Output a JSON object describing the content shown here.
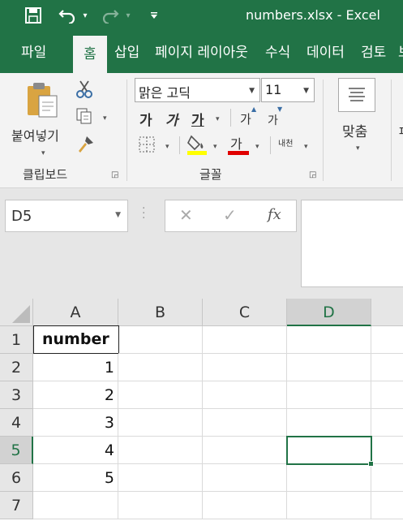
{
  "title_bar": {
    "title": "numbers.xlsx  -  Excel",
    "qat": [
      {
        "name": "save-icon",
        "glyph": "💾"
      },
      {
        "name": "undo-icon",
        "glyph": "↶"
      },
      {
        "name": "undo-dropdown-icon",
        "glyph": "▾"
      },
      {
        "name": "redo-icon",
        "glyph": "↷"
      },
      {
        "name": "redo-dropdown-icon",
        "glyph": "▾"
      },
      {
        "name": "customize-qat-icon",
        "glyph": "▾"
      }
    ]
  },
  "ribbon_tabs": [
    "파일",
    "홈",
    "삽입",
    "페이지 레이아웃",
    "수식",
    "데이터",
    "검토",
    "보"
  ],
  "active_tab": "홈",
  "clipboard": {
    "paste_label": "붙여넣기",
    "group_label": "클립보드"
  },
  "font": {
    "family": "맑은 고딕",
    "size": "11",
    "bold_glyph": "가",
    "italic_glyph": "가",
    "underline_glyph": "가",
    "grow_glyph": "가",
    "shrink_glyph": "가",
    "color_glyph": "가",
    "phonetic_glyph": "내천",
    "group_label": "글꼴",
    "font_color": "#e00000",
    "fill_color": "#ffff00"
  },
  "alignment": {
    "wrap_label": "맞춤"
  },
  "formula_bar": {
    "name_box": "D5",
    "cancel_glyph": "✕",
    "enter_glyph": "✓",
    "fx_glyph": "fx",
    "content": ""
  },
  "sheet": {
    "columns": [
      "A",
      "B",
      "C",
      "D"
    ],
    "selected_column": "D",
    "rows": [
      {
        "num": "1",
        "a": "number"
      },
      {
        "num": "2",
        "a": "1"
      },
      {
        "num": "3",
        "a": "2"
      },
      {
        "num": "4",
        "a": "3"
      },
      {
        "num": "5",
        "a": "4"
      },
      {
        "num": "6",
        "a": "5"
      },
      {
        "num": "7",
        "a": ""
      }
    ],
    "selected_row": "5",
    "active_cell": "D5"
  },
  "colors": {
    "accent": "#217346"
  }
}
